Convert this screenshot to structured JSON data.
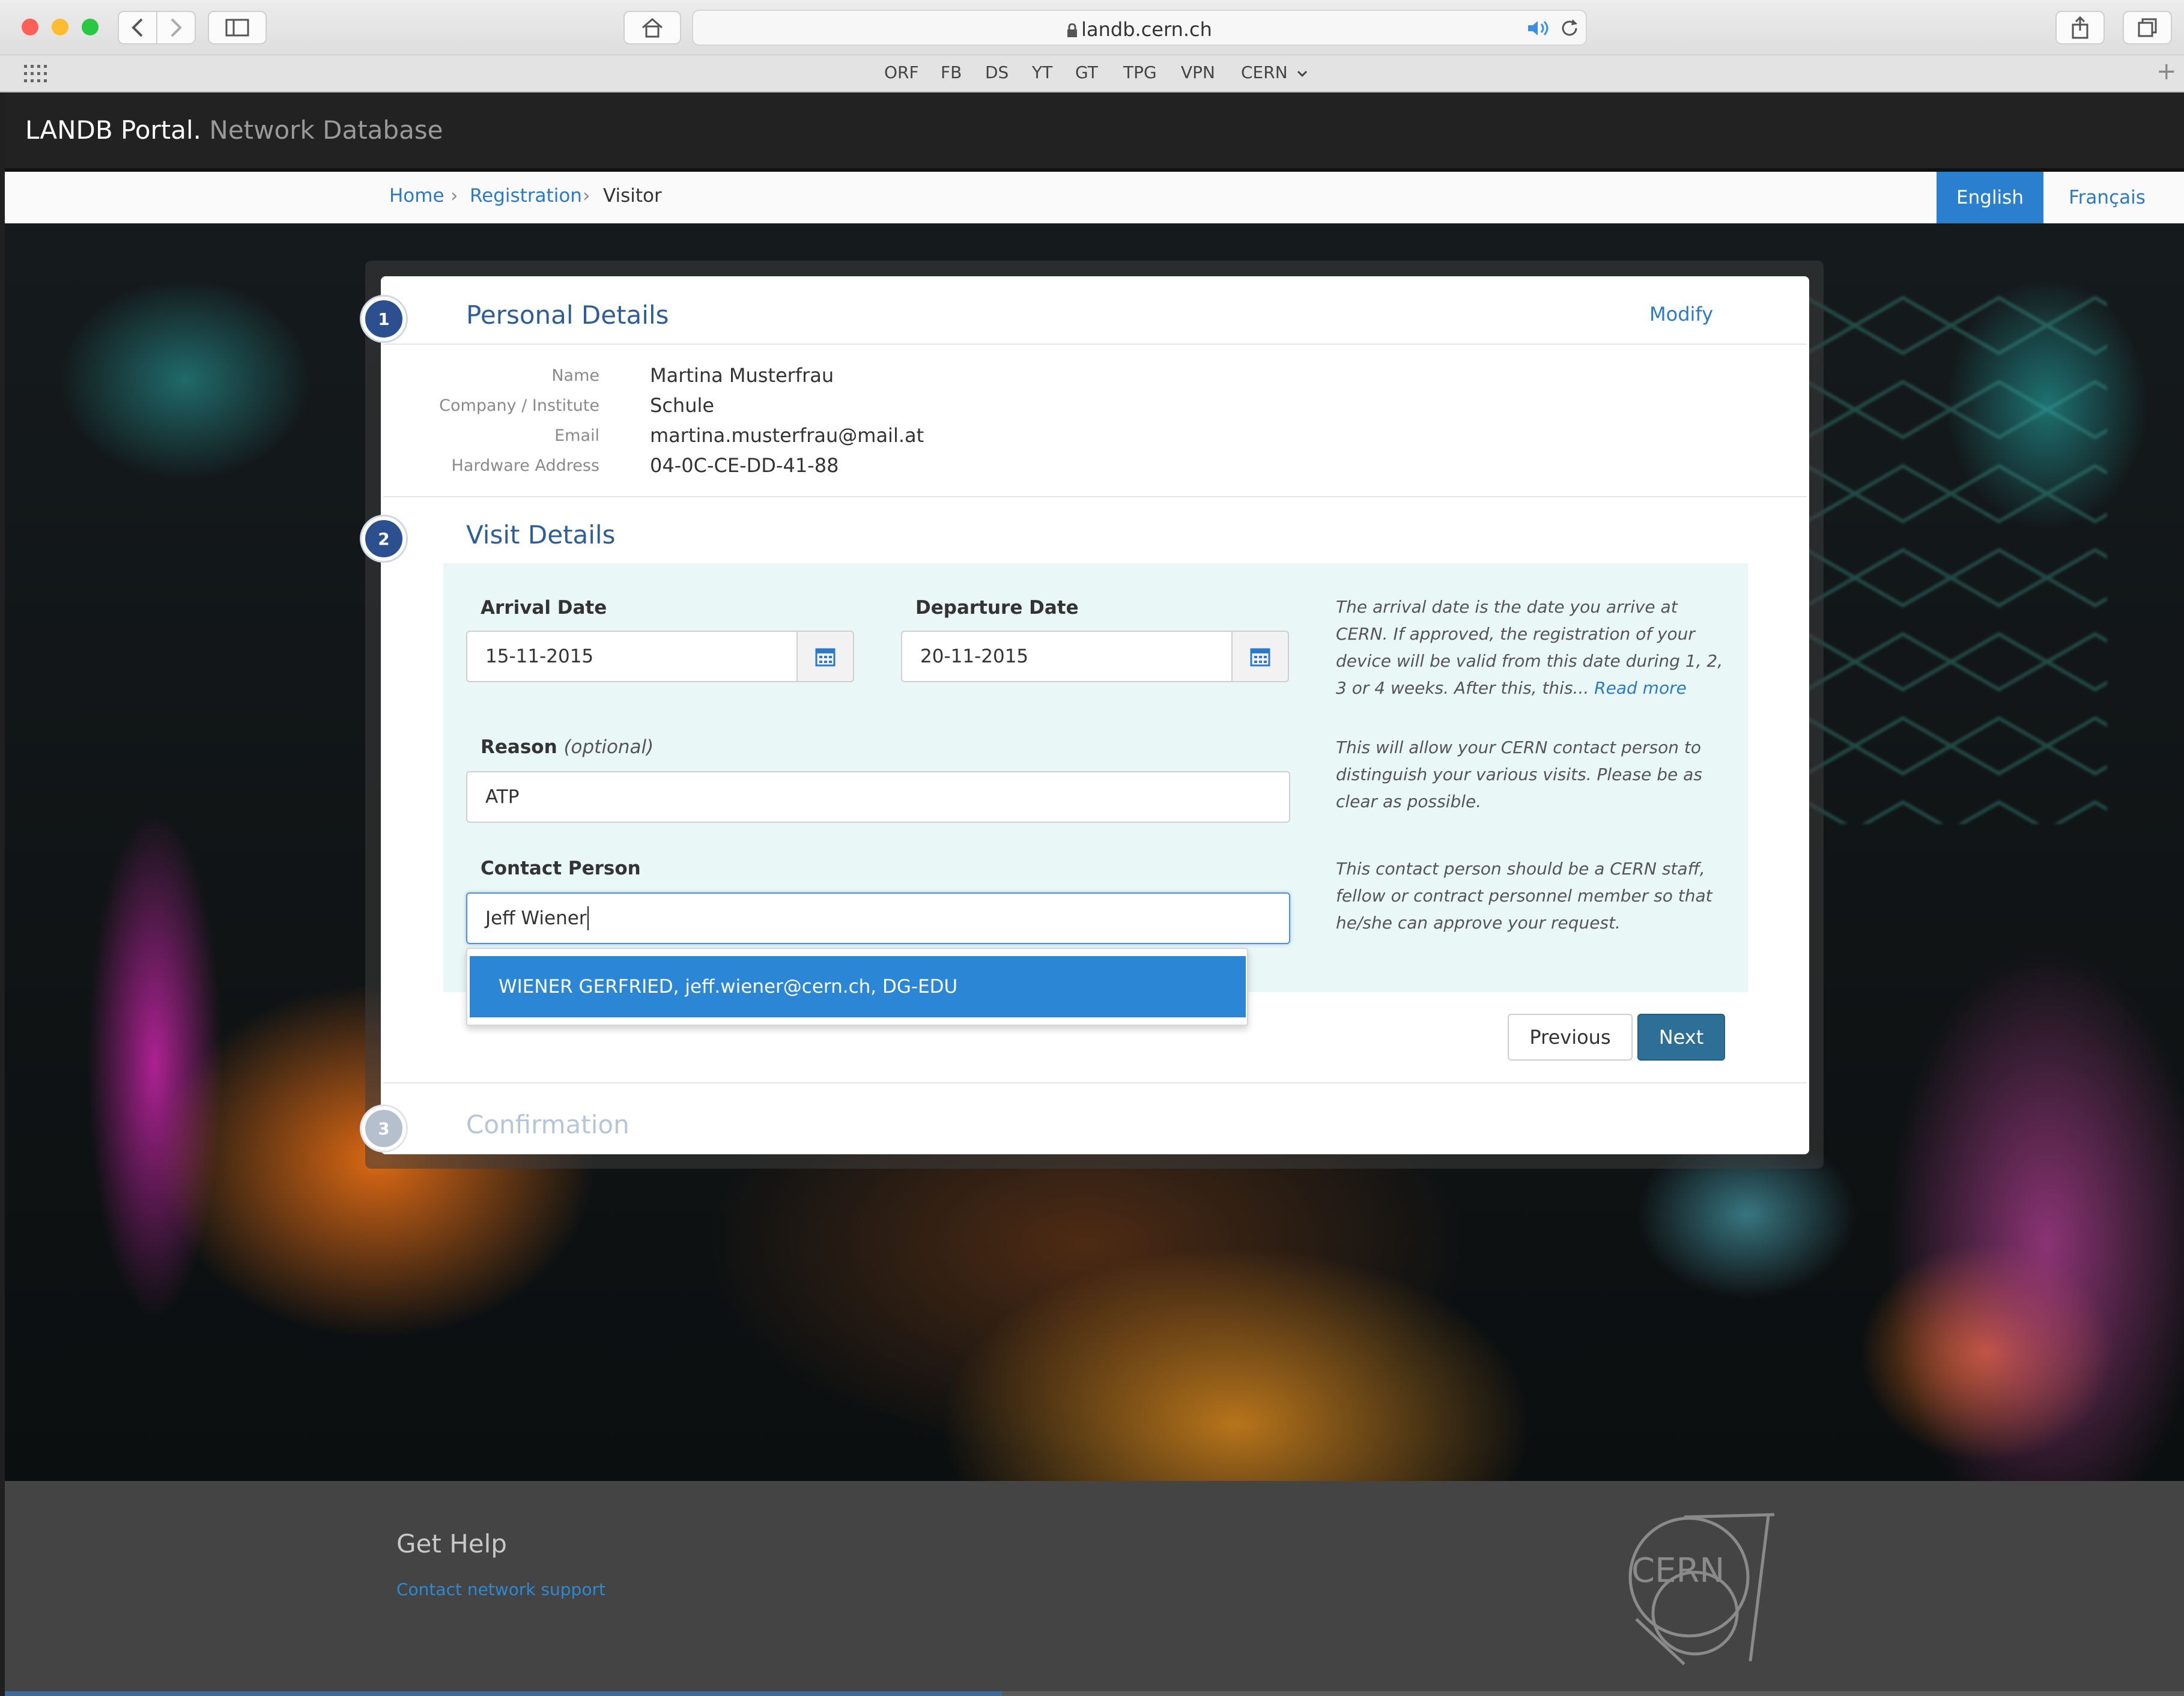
{
  "browser": {
    "url": "landb.cern.ch",
    "bookmarks": [
      "ORF",
      "FB",
      "DS",
      "YT",
      "GT",
      "TPG",
      "VPN",
      "CERN"
    ]
  },
  "header": {
    "brand": "LANDB Portal.",
    "subtitle": "Network Database"
  },
  "breadcrumb": {
    "home": "Home",
    "registration": "Registration",
    "current": "Visitor"
  },
  "language": {
    "english": "English",
    "french": "Français"
  },
  "personal": {
    "step": "1",
    "title": "Personal Details",
    "modify": "Modify",
    "fields": [
      {
        "label": "Name",
        "value": "Martina Musterfrau"
      },
      {
        "label": "Company / Institute",
        "value": "Schule"
      },
      {
        "label": "Email",
        "value": "martina.musterfrau@mail.at"
      },
      {
        "label": "Hardware Address",
        "value": "04-0C-CE-DD-41-88"
      }
    ]
  },
  "visit": {
    "step": "2",
    "title": "Visit Details",
    "arrival_label": "Arrival Date",
    "arrival_value": "15-11-2015",
    "departure_label": "Departure Date",
    "departure_value": "20-11-2015",
    "arrival_hint": "The arrival date is the date you arrive at CERN. If approved, the registration of your device will be valid from this date during 1, 2, 3 or 4 weeks. After this, this...",
    "read_more": "Read more",
    "reason_label": "Reason",
    "reason_optional": "(optional)",
    "reason_value": "ATP",
    "reason_hint": "This will allow your CERN contact person to distinguish your various visits. Please be as clear as possible.",
    "contact_label": "Contact Person",
    "contact_value": "Jeff Wiener",
    "contact_hint": "This contact person should be a CERN staff, fellow or contract personnel member so that he/she can approve your request.",
    "suggestion": "WIENER GERFRIED, jeff.wiener@cern.ch, DG-EDU",
    "previous": "Previous",
    "next": "Next"
  },
  "confirmation": {
    "step": "3",
    "title": "Confirmation"
  },
  "footer": {
    "title": "Get Help",
    "link": "Contact network support",
    "logo_text": "CERN"
  },
  "colors": {
    "accent": "#2b7fcf",
    "step": "#2b4f8f",
    "next_button": "#2e6f97",
    "panel": "#e9f7f6"
  }
}
